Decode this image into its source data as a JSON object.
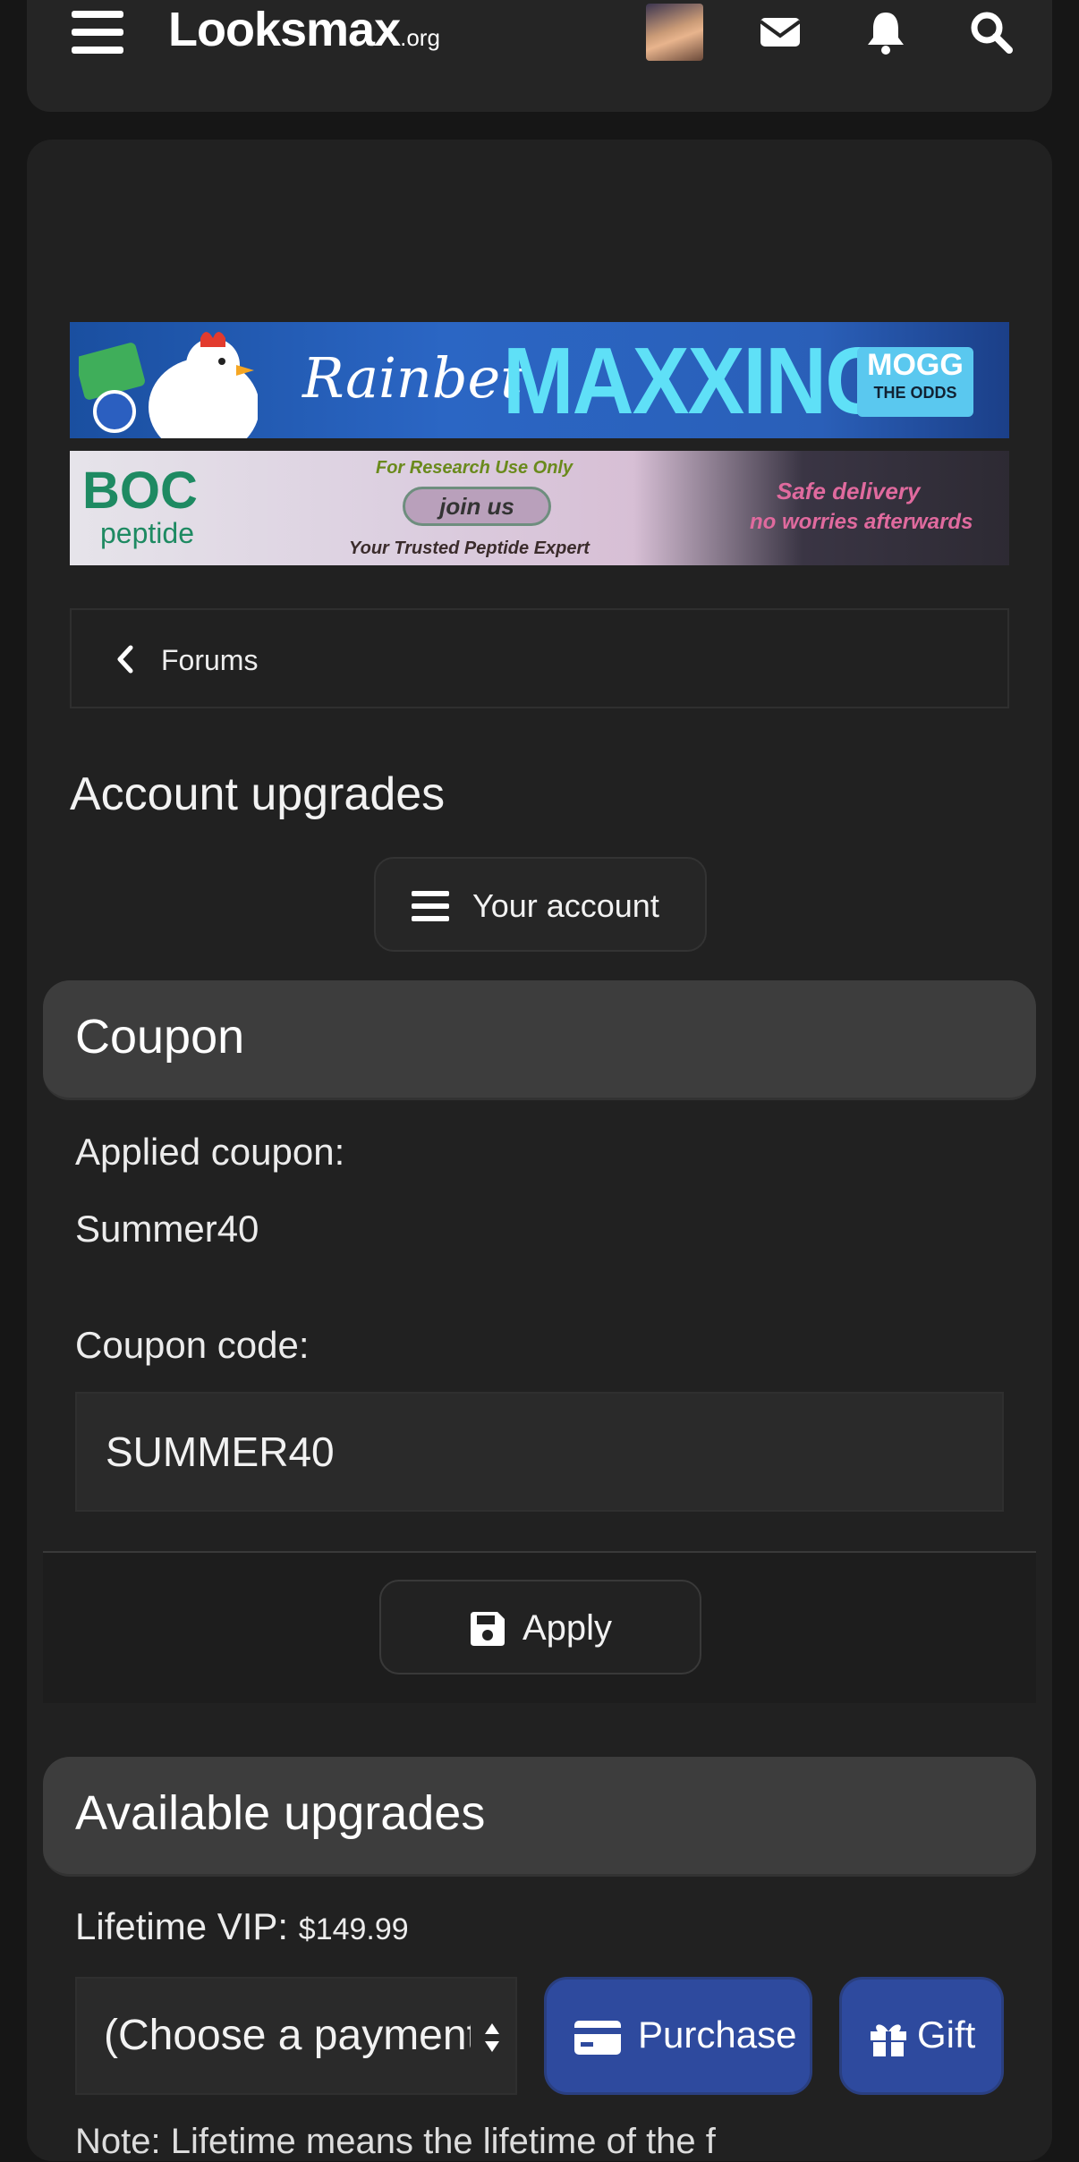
{
  "header": {
    "logo_main": "Looksmax",
    "logo_suffix": ".org"
  },
  "banners": {
    "rainbet": {
      "brand": "Rainbet",
      "headline": "MAXXING",
      "badge_line1": "MOGG",
      "badge_line2": "THE ODDS"
    },
    "boc": {
      "brand": "BOC",
      "brand_sub": "peptide",
      "research": "For Research Use Only",
      "cta": "join us",
      "tagline": "Your Trusted Peptide Expert",
      "safe": "Safe delivery",
      "worries": "no worries afterwards"
    }
  },
  "breadcrumb": {
    "label": "Forums"
  },
  "page": {
    "title": "Account upgrades"
  },
  "account_button": {
    "label": "Your account"
  },
  "coupon": {
    "heading": "Coupon",
    "applied_label": "Applied coupon:",
    "applied_value": "Summer40",
    "code_label": "Coupon code:",
    "code_value": "SUMMER40",
    "apply_label": "Apply"
  },
  "upgrades": {
    "heading": "Available upgrades",
    "items": [
      {
        "name": "Lifetime VIP:",
        "price": "$149.99",
        "payment_placeholder": "(Choose a payment",
        "purchase_label": "Purchase",
        "gift_label": "Gift"
      }
    ],
    "note": "Note: Lifetime means the lifetime of the f"
  },
  "colors": {
    "background": "#161616",
    "panel": "#212121",
    "block_header": "#3d3d3d",
    "primary_button": "#2e4a9e"
  }
}
